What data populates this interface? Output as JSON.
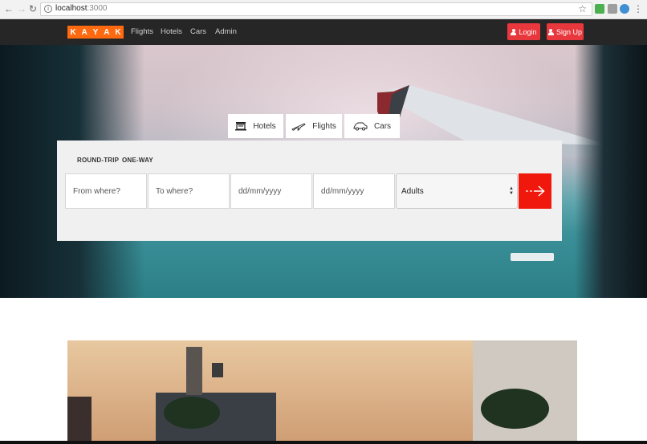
{
  "browser": {
    "url_host": "localhost",
    "url_port": ":3000"
  },
  "navbar": {
    "logo_letters": [
      "K",
      "A",
      "Y",
      "A",
      "K"
    ],
    "links": [
      "Flights",
      "Hotels",
      "Cars",
      "Admin"
    ],
    "login_label": "Login",
    "signup_label": "Sign Up"
  },
  "tabs": [
    {
      "label": "Hotels",
      "icon": "hotel-icon"
    },
    {
      "label": "Flights",
      "icon": "plane-icon"
    },
    {
      "label": "Cars",
      "icon": "car-icon"
    }
  ],
  "search": {
    "trip_types": [
      "ROUND-TRIP",
      "ONE-WAY"
    ],
    "from_placeholder": "From where?",
    "to_placeholder": "To where?",
    "depart_placeholder": "dd/mm/yyyy",
    "return_placeholder": "dd/mm/yyyy",
    "travelers_selected": "Adults",
    "submit_icon": "arrow-right-icon"
  },
  "colors": {
    "brand": "#ff690f",
    "auth_button": "#e8383d",
    "search_button": "#f0180c",
    "navbar": "#262626"
  }
}
